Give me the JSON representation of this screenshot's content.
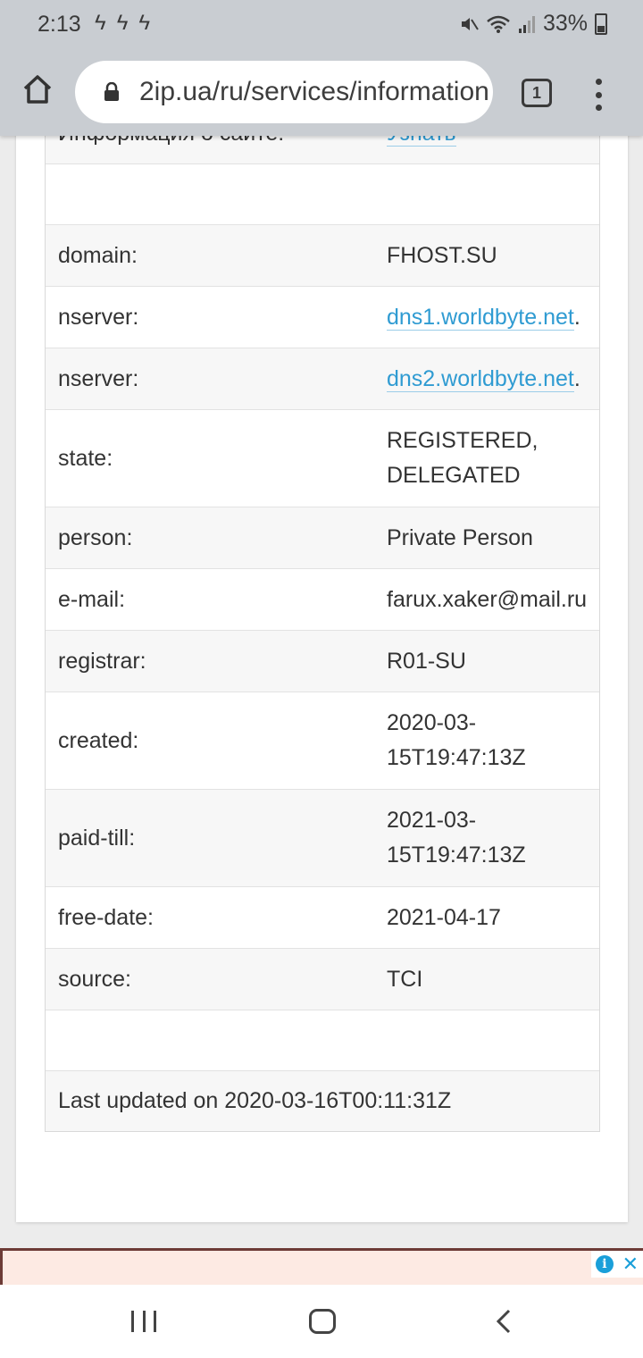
{
  "status_bar": {
    "time": "2:13",
    "battery_percent": "33%",
    "icons": [
      "bolt-icon",
      "bolt-icon",
      "bolt-icon",
      "mute-icon",
      "wifi-icon",
      "signal-icon",
      "battery-icon"
    ]
  },
  "browser": {
    "url": "2ip.ua/ru/services/information",
    "tab_count": "1"
  },
  "site_info": {
    "label": "Информация о сайте:",
    "link": "Узнать"
  },
  "whois": [
    {
      "key": "domain:",
      "value": "FHOST.SU"
    },
    {
      "key": "nserver:",
      "value": "dns1.worldbyte.net",
      "suffix": ".",
      "link": true
    },
    {
      "key": "nserver:",
      "value": "dns2.worldbyte.net",
      "suffix": ".",
      "link": true
    },
    {
      "key": "state:",
      "value": "REGISTERED,",
      "value2": "DELEGATED"
    },
    {
      "key": "person:",
      "value": "Private Person"
    },
    {
      "key": "e-mail:",
      "value": "farux.xaker@mail.ru"
    },
    {
      "key": "registrar:",
      "value": "R01-SU"
    },
    {
      "key": "created:",
      "value": "2020-03-",
      "value2": "15T19:47:13Z"
    },
    {
      "key": "paid-till:",
      "value": "2021-03-",
      "value2": "15T19:47:13Z"
    },
    {
      "key": "free-date:",
      "value": "2021-04-17"
    },
    {
      "key": "source:",
      "value": "TCI"
    }
  ],
  "last_updated": "Last updated on 2020-03-16T00:11:31Z",
  "colors": {
    "link": "#2f9bd2",
    "chrome": "#c9cdd2",
    "ad_bg": "#fdeae3"
  }
}
